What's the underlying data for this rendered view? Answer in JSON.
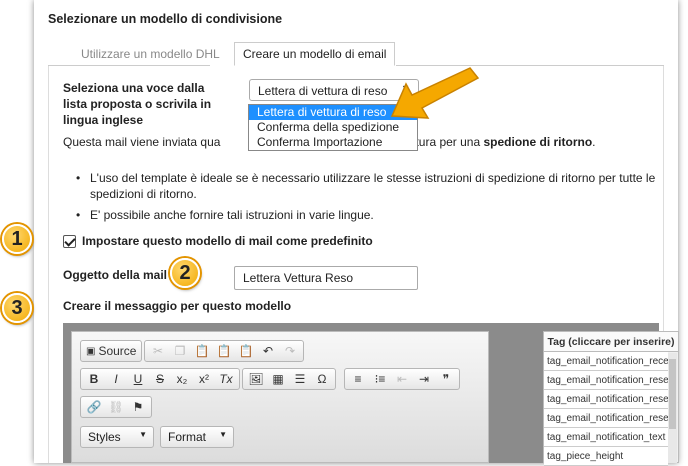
{
  "panel": {
    "title": "Selezionare un modello di condivisione"
  },
  "tabs": [
    {
      "label": "Utilizzare un modello DHL",
      "active": false
    },
    {
      "label": "Creare un modello di email",
      "active": true
    }
  ],
  "template_select": {
    "label": "Seleziona una voce dalla lista proposta o scrivila in lingua inglese",
    "value": "Lettera di vettura di reso",
    "options": [
      "Lettera di vettura di reso",
      "Conferma della spedizione",
      "Conferma Importazione"
    ],
    "highlighted_index": 0
  },
  "description": {
    "prefix": "Questa mail viene inviata qua",
    "suffix": "ettura per una ",
    "bold": "spedione di ritorno",
    "end": "."
  },
  "bullets": [
    "L'uso del template è ideale se è necessario utilizzare le stesse istruzioni di spedizione di ritorno per tutte le spedizioni di ritorno.",
    "E' possibile anche fornire tali istruzioni in varie lingue."
  ],
  "default_checkbox": {
    "label": "Impostare questo modello di mail come predefinito",
    "checked": true
  },
  "subject": {
    "label": "Oggetto della mail",
    "value": "Lettera Vettura Reso"
  },
  "message": {
    "label": "Creare il messaggio per questo modello"
  },
  "editor": {
    "source_label": "Source",
    "styles_label": "Styles",
    "format_label": "Format",
    "bold": "B",
    "italic": "I",
    "underline": "U",
    "strike": "S",
    "subscript": "x₂",
    "superscript": "x²",
    "remove_format": "Tx",
    "omega": "Ω",
    "quote": "❞"
  },
  "tags": {
    "header": "Tag (cliccare per inserire)",
    "items": [
      "tag_email_notification_recei",
      "tag_email_notification_reser",
      "tag_email_notification_reser",
      "tag_email_notification_reser",
      "tag_email_notification_text",
      "tag_piece_height"
    ]
  },
  "badges": [
    "1",
    "2",
    "3"
  ],
  "colors": {
    "badge": "#f2a900",
    "arrow": "#f5a800",
    "selected_option": "#1e90ff",
    "editor_frame": "#8b8b8b"
  }
}
